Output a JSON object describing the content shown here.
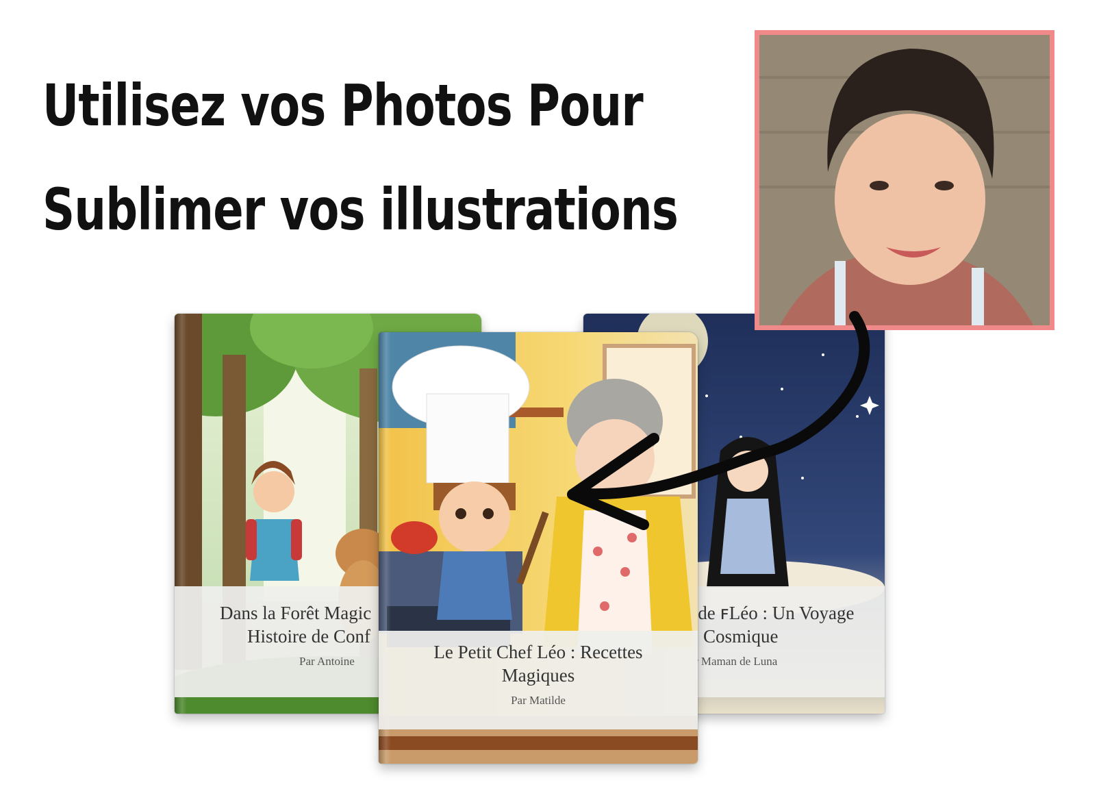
{
  "headline": {
    "line1": "Utilisez vos Photos Pour",
    "line2": "Sublimer vos illustrations"
  },
  "photo": {
    "border_color": "#f08a8a",
    "subject": "child-portrait-photo"
  },
  "books": {
    "left": {
      "title_line1": "Dans la Forêt Magic",
      "title_line2": "Histoire de Conf",
      "author": "Par Antoine"
    },
    "center": {
      "title_line1": "Le Petit Chef Léo : Recettes",
      "title_line2": "Magiques",
      "author": "Par Matilde"
    },
    "right": {
      "title_line1": "s de ꜰLéo : Un Voyage",
      "title_line2": "Cosmique",
      "author": "r Maman de Luna"
    }
  },
  "arrow_icon": "curved-arrow-icon"
}
